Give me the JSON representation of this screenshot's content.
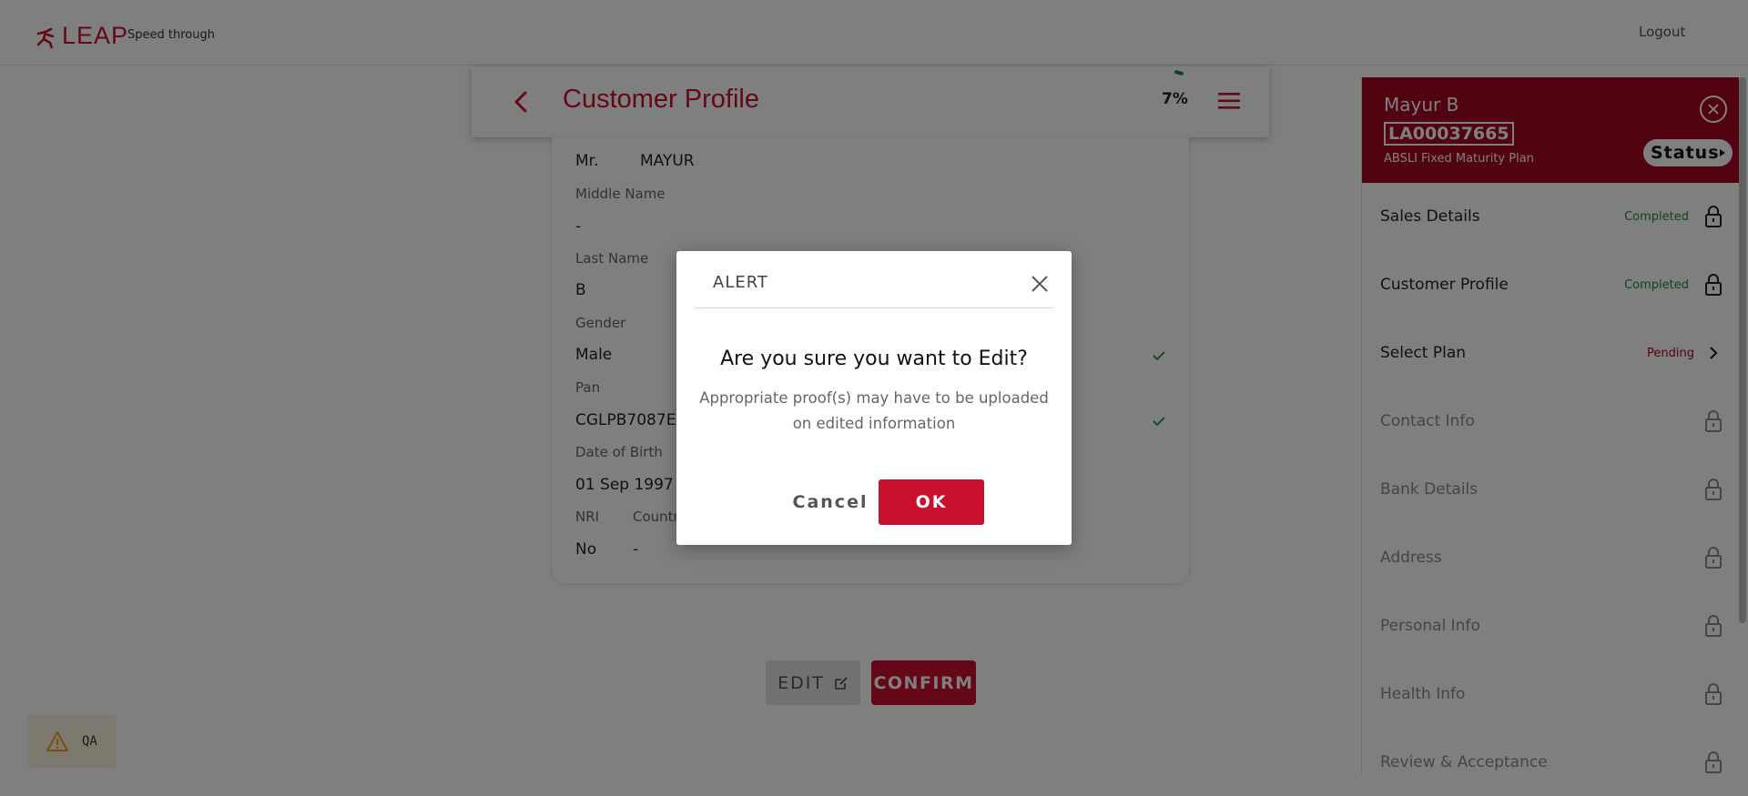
{
  "brand": {
    "name": "LEAP",
    "tagline": "Speed through",
    "accent": "#c8102e"
  },
  "topbar": {
    "logout_label": "Logout"
  },
  "header": {
    "title": "Customer Profile",
    "progress_label": "7%",
    "progress_fraction": 0.07
  },
  "form": {
    "salutation": "Mr.",
    "first_name": "MAYUR",
    "middle_name_label": "Middle Name",
    "middle_name_value": "-",
    "last_name_label": "Last Name",
    "last_name_value": "B",
    "gender_label": "Gender",
    "gender_value": "Male",
    "pan_label": "Pan",
    "pan_value": "CGLPB7087E",
    "dob_label": "Date of Birth",
    "dob_value": "01 Sep 1997",
    "nri_label": "NRI",
    "nri_value": "No",
    "country_label": "Country",
    "country_value": "-"
  },
  "actions": {
    "edit_label": "EDIT",
    "confirm_label": "CONFIRM"
  },
  "qa_badge": {
    "label": "QA"
  },
  "side_panel": {
    "customer_name": "Mayur B",
    "application_id": "LA00037665",
    "plan_name": "ABSLI Fixed Maturity Plan",
    "status_label": "Status",
    "steps": [
      {
        "label": "Sales Details",
        "status": "Completed",
        "state": "completed"
      },
      {
        "label": "Customer Profile",
        "status": "Completed",
        "state": "completed"
      },
      {
        "label": "Select Plan",
        "status": "Pending",
        "state": "pending"
      },
      {
        "label": "Contact Info",
        "status": "",
        "state": "locked"
      },
      {
        "label": "Bank Details",
        "status": "",
        "state": "locked"
      },
      {
        "label": "Address",
        "status": "",
        "state": "locked"
      },
      {
        "label": "Personal Info",
        "status": "",
        "state": "locked"
      },
      {
        "label": "Health Info",
        "status": "",
        "state": "locked"
      },
      {
        "label": "Review & Acceptance",
        "status": "",
        "state": "locked"
      }
    ]
  },
  "modal": {
    "title": "ALERT",
    "question": "Are you sure you want to Edit?",
    "message": "Appropriate proof(s) may have to be uploaded on edited information",
    "cancel_label": "Cancel",
    "ok_label": "OK"
  }
}
